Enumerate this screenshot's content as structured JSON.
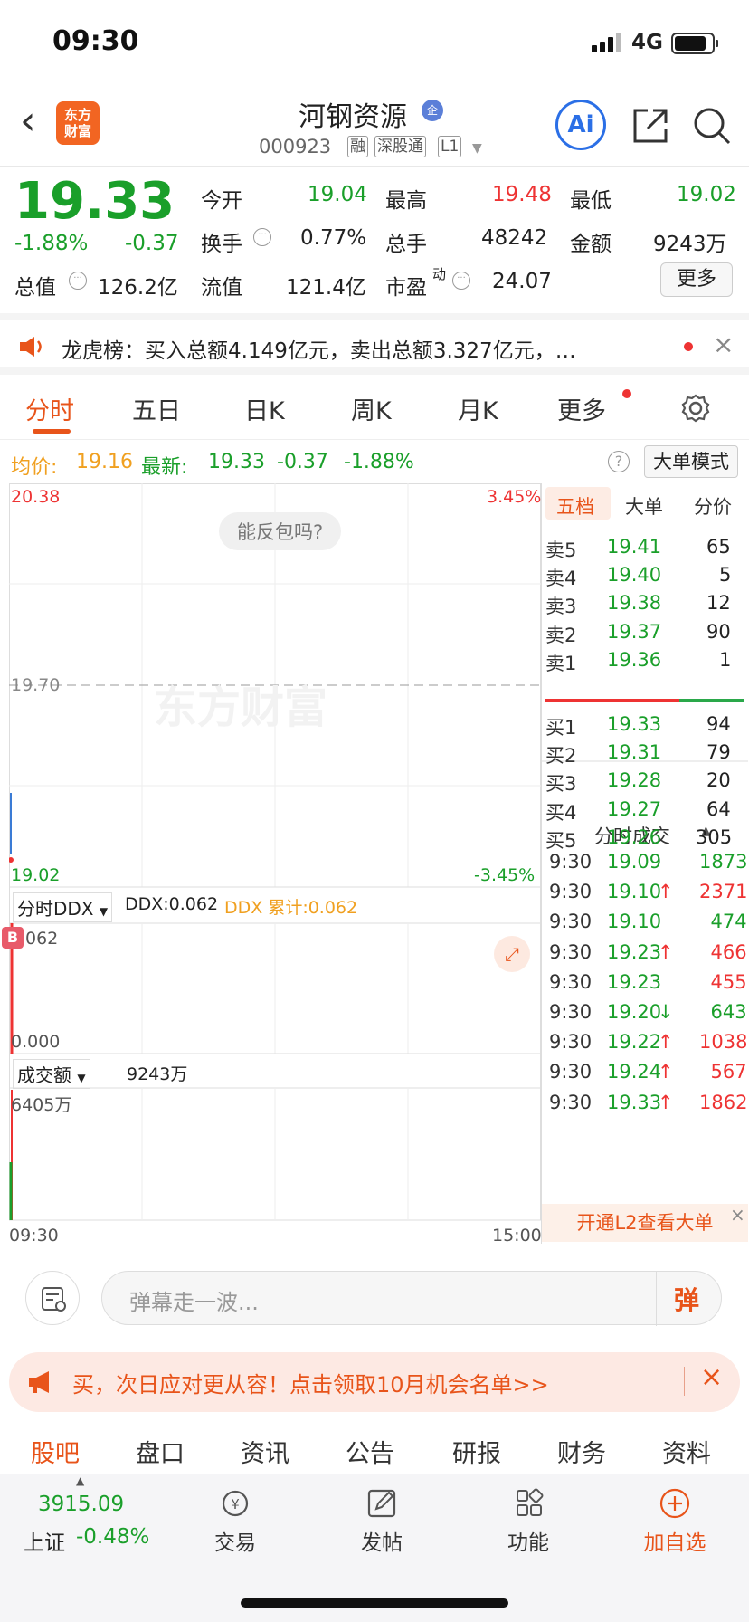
{
  "status_bar": {
    "time": "09:30",
    "network": "4G"
  },
  "header": {
    "brand": "东方\n财富",
    "stock_name": "河钢资源",
    "badge": "企",
    "code": "000923",
    "tags": [
      "融",
      "深股通",
      "L1"
    ],
    "ai_label": "Ai"
  },
  "quote": {
    "price": "19.33",
    "change_pct": "-1.88%",
    "change": "-0.37",
    "open_label": "今开",
    "open": "19.04",
    "high_label": "最高",
    "high": "19.48",
    "low_label": "最低",
    "low": "19.02",
    "turnover_label": "换手",
    "turnover": "0.77%",
    "volume_label": "总手",
    "volume": "48242",
    "amount_label": "金额",
    "amount": "9243万",
    "mcap_label": "总值",
    "mcap": "126.2亿",
    "float_label": "流值",
    "float": "121.4亿",
    "pe_label": "市盈",
    "pe_sup": "动",
    "pe": "24.07",
    "more": "更多"
  },
  "notice": {
    "text": "龙虎榜：买入总额4.149亿元，卖出总额3.327亿元，…"
  },
  "tabs": [
    "分时",
    "五日",
    "日K",
    "周K",
    "月K",
    "更多"
  ],
  "info_bar": {
    "avg_label": "均价:",
    "avg": "19.16",
    "latest_label": "最新:",
    "latest": "19.33",
    "chg": "-0.37",
    "pct": "-1.88%",
    "mode": "大单模式"
  },
  "chart_data": {
    "type": "line",
    "y_top": "20.38",
    "y_mid": "19.70",
    "y_bottom": "19.02",
    "pct_top": "3.45%",
    "pct_bottom": "-3.45%",
    "bubble": "能反包吗?",
    "watermark": "东方财富",
    "ddx_selector": "分时DDX",
    "ddx_value": "DDX:0.062",
    "ddx_cum": "DDX 累计:0.062",
    "ddx_top": "062",
    "ddx_bottom": "0.000",
    "ddx_badge": "B",
    "vol_selector": "成交额",
    "vol_value": "9243万",
    "vol_top": "6405万",
    "x_start": "09:30",
    "x_end": "15:00"
  },
  "orderbook": {
    "tabs": [
      "五档",
      "大单",
      "分价"
    ],
    "asks": [
      {
        "label": "卖5",
        "price": "19.41",
        "vol": "65"
      },
      {
        "label": "卖4",
        "price": "19.40",
        "vol": "5"
      },
      {
        "label": "卖3",
        "price": "19.38",
        "vol": "12"
      },
      {
        "label": "卖2",
        "price": "19.37",
        "vol": "90"
      },
      {
        "label": "卖1",
        "price": "19.36",
        "vol": "1"
      }
    ],
    "bids": [
      {
        "label": "买1",
        "price": "19.33",
        "vol": "94"
      },
      {
        "label": "买2",
        "price": "19.31",
        "vol": "79"
      },
      {
        "label": "买3",
        "price": "19.28",
        "vol": "20"
      },
      {
        "label": "买4",
        "price": "19.27",
        "vol": "64"
      },
      {
        "label": "买5",
        "price": "19.26",
        "vol": "305"
      }
    ],
    "ticks_title": "分时成交",
    "ticks": [
      {
        "t": "9:30",
        "p": "19.09",
        "a": "",
        "v": "1873",
        "vc": "green"
      },
      {
        "t": "9:30",
        "p": "19.10",
        "a": "↑",
        "v": "2371",
        "vc": "red"
      },
      {
        "t": "9:30",
        "p": "19.10",
        "a": "",
        "v": "474",
        "vc": "green"
      },
      {
        "t": "9:30",
        "p": "19.23",
        "a": "↑",
        "v": "466",
        "vc": "red"
      },
      {
        "t": "9:30",
        "p": "19.23",
        "a": "",
        "v": "455",
        "vc": "red"
      },
      {
        "t": "9:30",
        "p": "19.20",
        "a": "↓",
        "v": "643",
        "vc": "green"
      },
      {
        "t": "9:30",
        "p": "19.22",
        "a": "↑",
        "v": "1038",
        "vc": "red"
      },
      {
        "t": "9:30",
        "p": "19.24",
        "a": "↑",
        "v": "567",
        "vc": "red"
      },
      {
        "t": "9:30",
        "p": "19.33",
        "a": "↑",
        "v": "1862",
        "vc": "red"
      }
    ],
    "l2": "开通L2查看大单"
  },
  "comment": {
    "placeholder": "弹幕走一波...",
    "send": "弹"
  },
  "promo": {
    "text": "买，次日应对更从容！点击领取10月机会名单>>"
  },
  "subtabs": [
    "股吧",
    "盘口",
    "资讯",
    "公告",
    "研报",
    "财务",
    "资料"
  ],
  "dock": {
    "index_value": "3915.09",
    "index_name": "上证",
    "index_pct": "-0.48%",
    "items": [
      "交易",
      "发帖",
      "功能",
      "加自选"
    ]
  }
}
